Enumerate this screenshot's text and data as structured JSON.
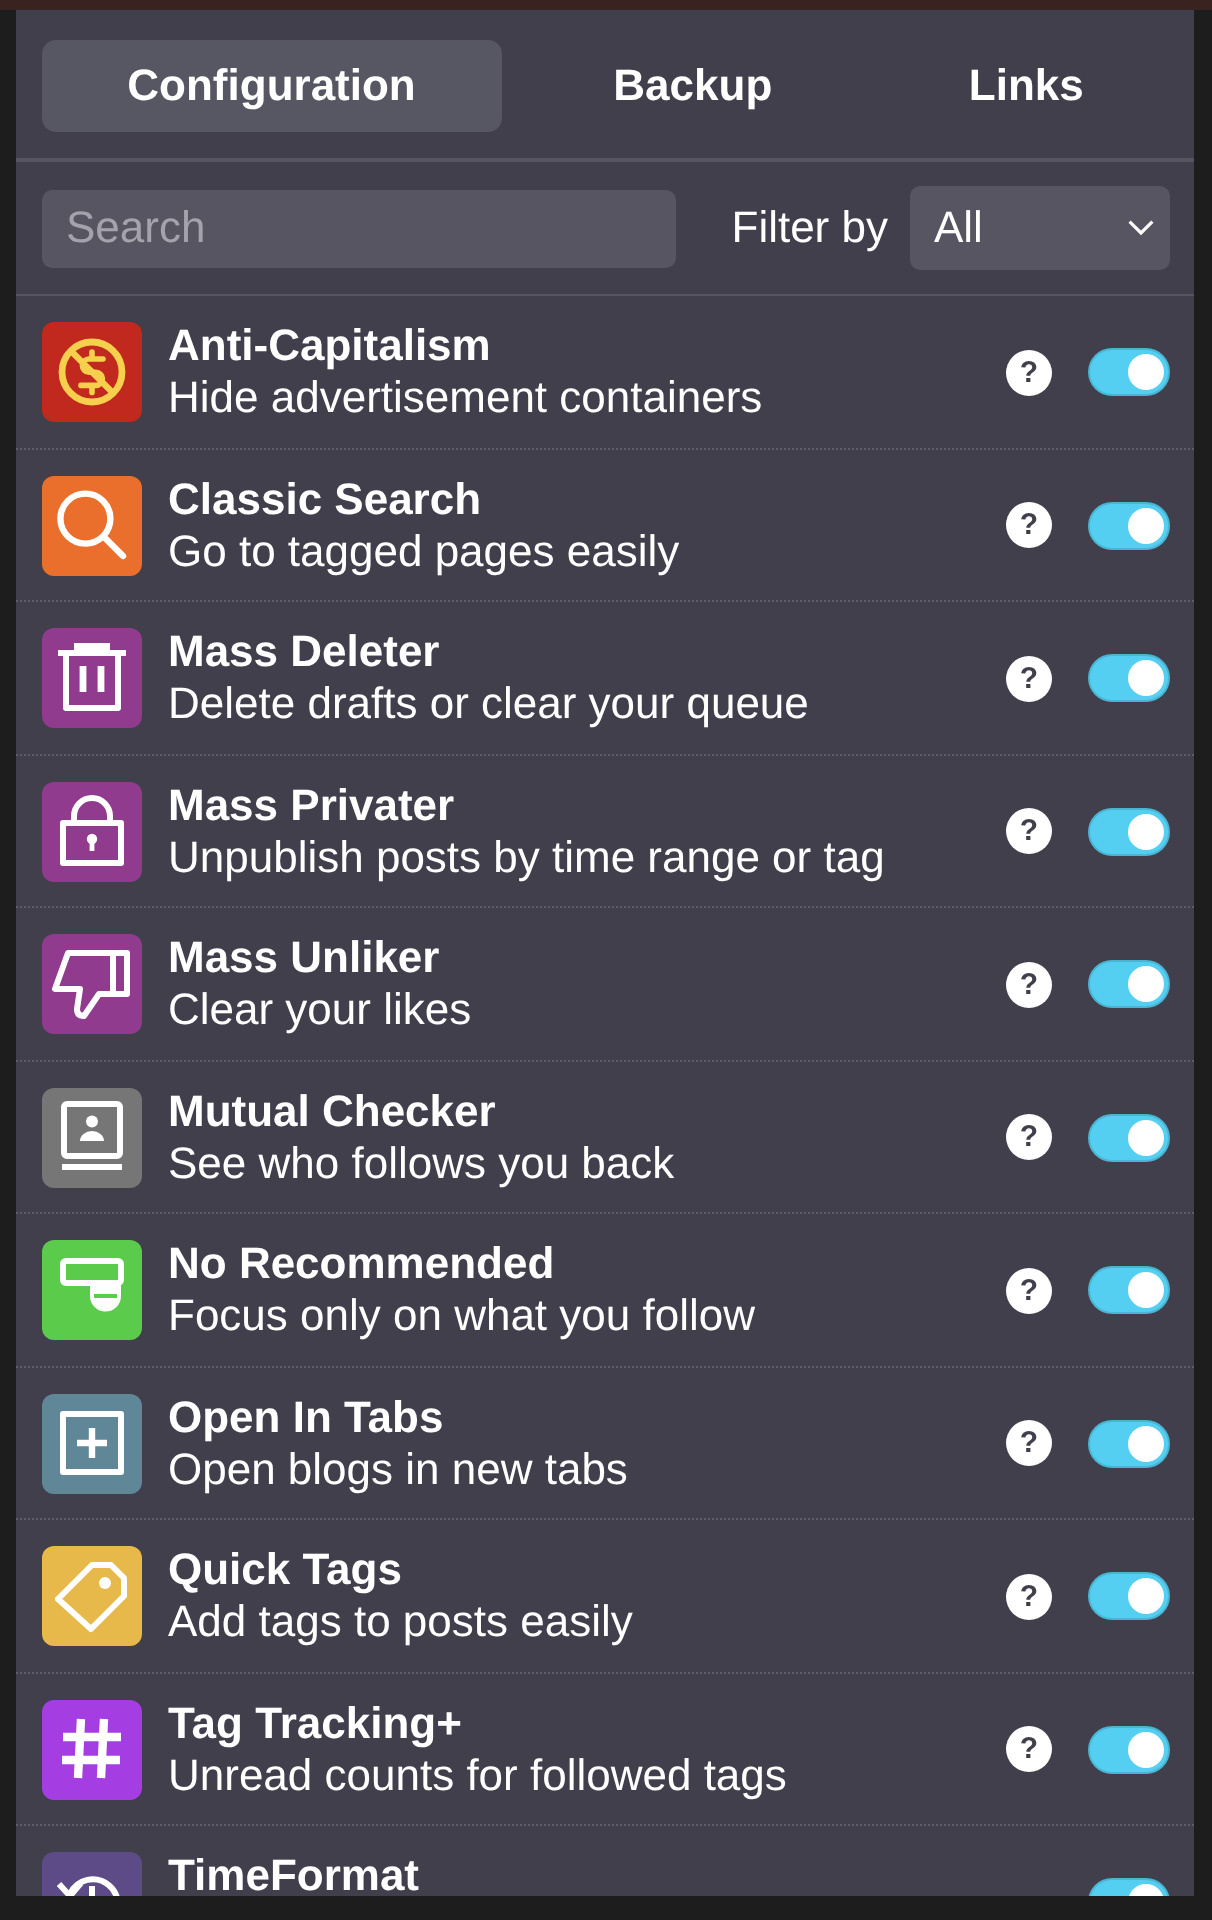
{
  "tabs": [
    {
      "label": "Configuration",
      "selected": true
    },
    {
      "label": "Backup",
      "selected": false
    },
    {
      "label": "Links",
      "selected": false
    }
  ],
  "search": {
    "placeholder": "Search"
  },
  "filter": {
    "label": "Filter by",
    "value": "All"
  },
  "features": [
    {
      "kind": "currency",
      "color": "#c1281e",
      "title": "Anti-Capitalism",
      "description": "Hide advertisement containers",
      "help": "?",
      "on": true
    },
    {
      "kind": "search",
      "color": "#ea6f2c",
      "title": "Classic Search",
      "description": "Go to tagged pages easily",
      "help": "?",
      "on": true
    },
    {
      "kind": "trash",
      "color": "#903b8e",
      "title": "Mass Deleter",
      "description": "Delete drafts or clear your queue",
      "help": "?",
      "on": true
    },
    {
      "kind": "lock",
      "color": "#903b8e",
      "title": "Mass Privater",
      "description": "Unpublish posts by time range or tag",
      "help": "?",
      "on": true
    },
    {
      "kind": "dislike",
      "color": "#903b8e",
      "title": "Mass Unliker",
      "description": "Clear your likes",
      "help": "?",
      "on": true
    },
    {
      "kind": "contact",
      "color": "#767676",
      "title": "Mutual Checker",
      "description": "See who follows you back",
      "help": "?",
      "on": true
    },
    {
      "kind": "banner",
      "color": "#5bcb4b",
      "title": "No Recommended",
      "description": "Focus only on what you follow",
      "help": "?",
      "on": true
    },
    {
      "kind": "plus",
      "color": "#5f8797",
      "title": "Open In Tabs",
      "description": "Open blogs in new tabs",
      "help": "?",
      "on": true
    },
    {
      "kind": "tag",
      "color": "#e7b94a",
      "title": "Quick Tags",
      "description": "Add tags to posts easily",
      "help": "?",
      "on": true
    },
    {
      "kind": "hash",
      "color": "#a53ee2",
      "title": "Tag Tracking+",
      "description": "Unread counts for followed tags",
      "help": "?",
      "on": true
    },
    {
      "kind": "history",
      "color": "#5d4b87",
      "title": "TimeFormat",
      "on": true
    }
  ]
}
